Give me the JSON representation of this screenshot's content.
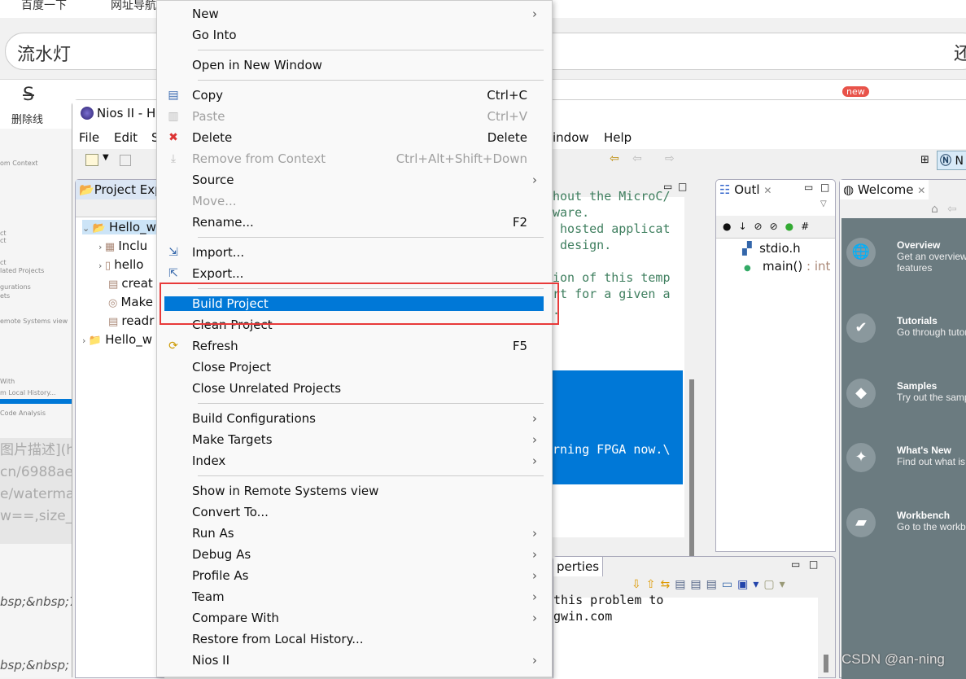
{
  "browser": {
    "bookmarks": [
      "百度一下",
      "网址导航"
    ],
    "search_value": "流水灯",
    "right_cut": "还",
    "strikethrough_label": "删除线",
    "new_badge": "new"
  },
  "left_strip": {
    "items": [
      "om Context",
      "ct",
      "ct",
      "ct",
      "lated Projects",
      "gurations",
      "ets",
      "emote Systems view",
      "With",
      "m Local History...",
      "Code Analysis"
    ],
    "markdown_lines": [
      "图片描述](h",
      "cn/6988ae",
      "e/waterma",
      "w==,size_",
      "bsp;&nbsp;7",
      "bsp;&nbsp;"
    ]
  },
  "eclipse": {
    "title": "Nios II - H",
    "menus": [
      "File",
      "Edit",
      "S",
      "indow",
      "Help"
    ],
    "project_explorer": {
      "tab": "Project Exp",
      "tree": [
        {
          "label": "Hello_w",
          "icon": "c-project-open-icon",
          "expanded": true
        },
        {
          "label": "Inclu",
          "icon": "includes-icon"
        },
        {
          "label": "hello",
          "icon": "c-source-icon"
        },
        {
          "label": "creat",
          "icon": "file-icon"
        },
        {
          "label": "Make",
          "icon": "makefile-icon"
        },
        {
          "label": "readr",
          "icon": "file-icon"
        },
        {
          "label": "Hello_w",
          "icon": "c-project-icon",
          "expanded": false
        }
      ]
    },
    "editor": {
      "lines": [
        "hout the MicroC/",
        "ware.",
        " hosted applicat",
        " design.",
        "",
        "ion of this temp",
        "rt for a given a",
        "."
      ],
      "selected_line": "rning FPGA now.\\"
    },
    "outline": {
      "tab": "Outl",
      "items": [
        {
          "label": "stdio.h",
          "icon": "include-icon"
        },
        {
          "label": "main()",
          "type": " : int",
          "icon": "function-icon"
        }
      ]
    },
    "welcome": {
      "tab": "Welcome",
      "items": [
        {
          "title": "Overview",
          "desc": "Get an overview",
          "desc2": "features",
          "icon": "globe-icon"
        },
        {
          "title": "Tutorials",
          "desc": "Go through tutori",
          "icon": "tutorial-icon"
        },
        {
          "title": "Samples",
          "desc": "Try out the samp",
          "icon": "samples-icon"
        },
        {
          "title": "What's New",
          "desc": "Find out what is",
          "icon": "star-icon"
        },
        {
          "title": "Workbench",
          "desc": "Go to the workbe",
          "icon": "workbench-icon"
        }
      ]
    },
    "bottom": {
      "tab": "perties",
      "lines": [
        "this problem to",
        "gwin.com"
      ]
    },
    "perspective": "N"
  },
  "context_menu": {
    "items": [
      {
        "label": "New",
        "submenu": true
      },
      {
        "label": "Go Into"
      },
      {
        "sep": true
      },
      {
        "label": "Open in New Window"
      },
      {
        "sep": true
      },
      {
        "label": "Copy",
        "shortcut": "Ctrl+C",
        "icon": "copy-icon"
      },
      {
        "label": "Paste",
        "shortcut": "Ctrl+V",
        "icon": "paste-icon",
        "disabled": true
      },
      {
        "label": "Delete",
        "shortcut": "Delete",
        "icon": "delete-icon"
      },
      {
        "label": "Remove from Context",
        "shortcut": "Ctrl+Alt+Shift+Down",
        "icon": "remove-context-icon",
        "disabled": true
      },
      {
        "label": "Source",
        "submenu": true
      },
      {
        "label": "Move...",
        "disabled": true
      },
      {
        "label": "Rename...",
        "shortcut": "F2"
      },
      {
        "sep": true
      },
      {
        "label": "Import...",
        "icon": "import-icon"
      },
      {
        "label": "Export...",
        "icon": "export-icon"
      },
      {
        "sep": true
      },
      {
        "label": "Build Project",
        "highlighted": true
      },
      {
        "label": "Clean Project"
      },
      {
        "label": "Refresh",
        "shortcut": "F5",
        "icon": "refresh-icon"
      },
      {
        "label": "Close Project"
      },
      {
        "label": "Close Unrelated Projects"
      },
      {
        "sep": true
      },
      {
        "label": "Build Configurations",
        "submenu": true
      },
      {
        "label": "Make Targets",
        "submenu": true
      },
      {
        "label": "Index",
        "submenu": true
      },
      {
        "sep": true
      },
      {
        "label": "Show in Remote Systems view"
      },
      {
        "label": "Convert To..."
      },
      {
        "label": "Run As",
        "submenu": true
      },
      {
        "label": "Debug As",
        "submenu": true
      },
      {
        "label": "Profile As",
        "submenu": true
      },
      {
        "label": "Team",
        "submenu": true
      },
      {
        "label": "Compare With",
        "submenu": true
      },
      {
        "label": "Restore from Local History..."
      },
      {
        "label": "Nios II",
        "submenu": true
      }
    ]
  },
  "watermark": "CSDN @an-ning",
  "colors": {
    "highlight": "#0078d7",
    "annotation_box": "#e83a3a",
    "welcome_bg": "#6b7b80"
  }
}
